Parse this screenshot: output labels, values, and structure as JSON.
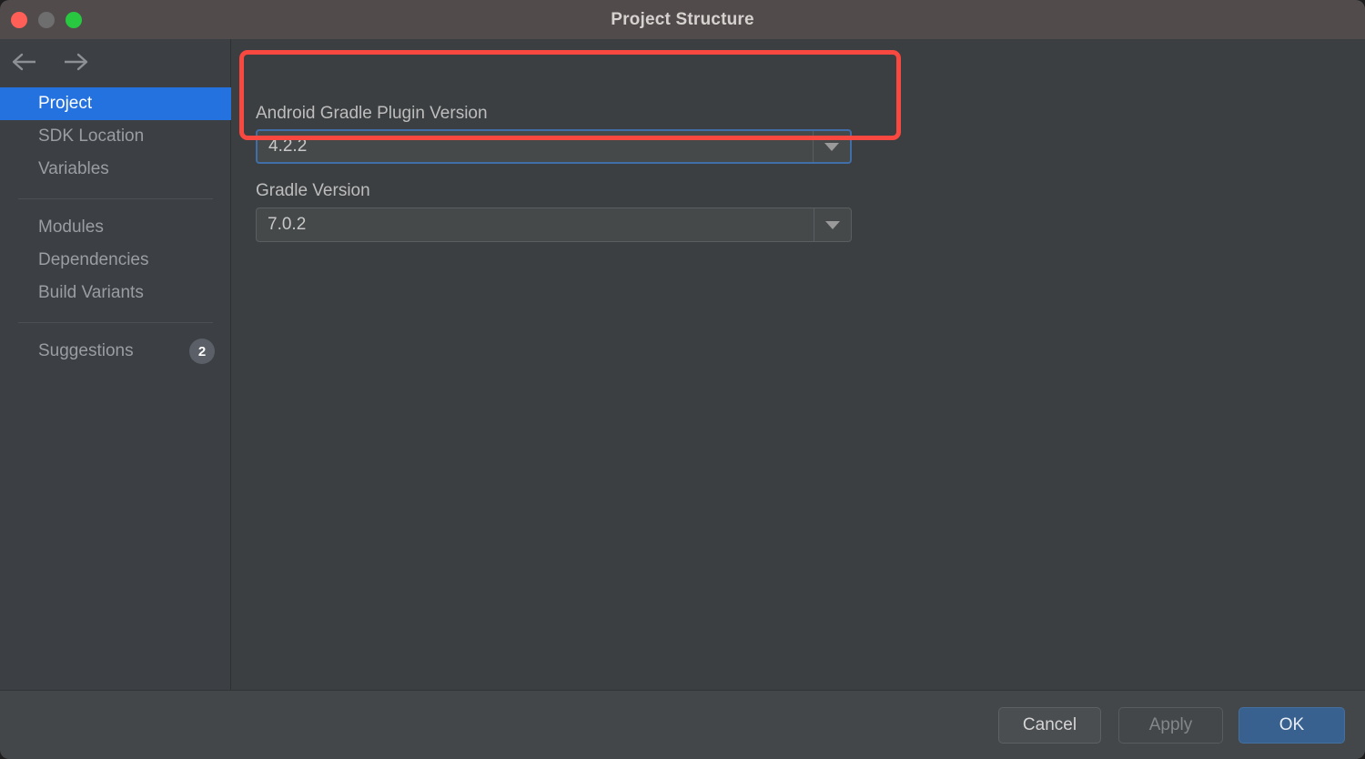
{
  "window": {
    "title": "Project Structure",
    "traffic_lights": [
      {
        "name": "close",
        "color": "#ff5f57"
      },
      {
        "name": "minimize",
        "color": "#6e6e6e"
      },
      {
        "name": "zoom",
        "color": "#28c840"
      }
    ]
  },
  "sidebar": {
    "nav": {
      "back_icon": "arrow-left-icon",
      "forward_icon": "arrow-right-icon"
    },
    "groups": [
      {
        "items": [
          {
            "label": "Project",
            "selected": true
          },
          {
            "label": "SDK Location",
            "selected": false
          },
          {
            "label": "Variables",
            "selected": false
          }
        ]
      },
      {
        "items": [
          {
            "label": "Modules",
            "selected": false
          },
          {
            "label": "Dependencies",
            "selected": false
          },
          {
            "label": "Build Variants",
            "selected": false
          }
        ]
      },
      {
        "items": [
          {
            "label": "Suggestions",
            "selected": false,
            "badge": "2"
          }
        ]
      }
    ],
    "selection_color": "#2471e0"
  },
  "main": {
    "fields": [
      {
        "label": "Android Gradle Plugin Version",
        "value": "4.2.2",
        "focused": true,
        "dropdown_icon": "chevron-down-icon"
      },
      {
        "label": "Gradle Version",
        "value": "7.0.2",
        "focused": false,
        "dropdown_icon": "chevron-down-icon"
      }
    ],
    "annotation": {
      "color": "#f9483f",
      "target": "Android Gradle Plugin Version"
    }
  },
  "footer": {
    "buttons": [
      {
        "label": "Cancel",
        "style": "secondary",
        "enabled": true
      },
      {
        "label": "Apply",
        "style": "disabled",
        "enabled": false
      },
      {
        "label": "OK",
        "style": "primary",
        "enabled": true
      }
    ],
    "primary_color": "#38618f"
  }
}
